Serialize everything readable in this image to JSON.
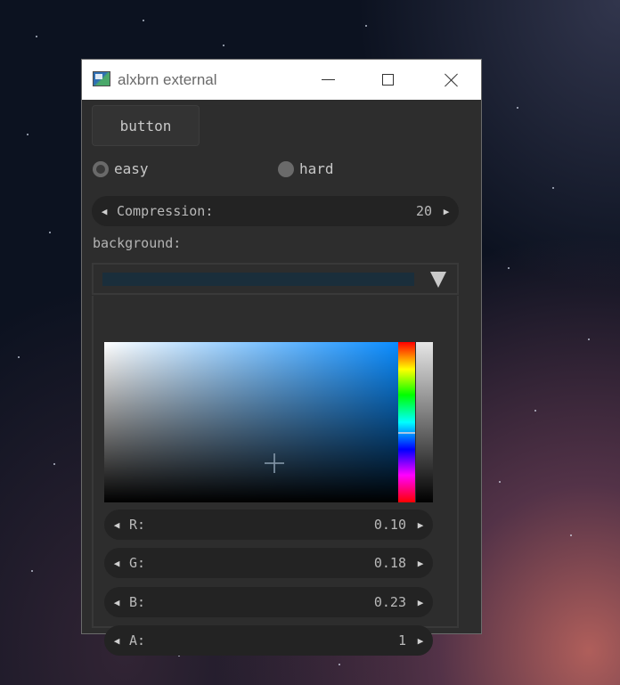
{
  "window": {
    "title": "alxbrn external"
  },
  "button": {
    "label": "button"
  },
  "difficulty": {
    "options": [
      {
        "label": "easy",
        "selected": true
      },
      {
        "label": "hard",
        "selected": false
      }
    ]
  },
  "compression": {
    "label": "Compression:",
    "value": "20"
  },
  "background": {
    "label": "background:",
    "swatch_color": "#1a2e3b",
    "channels": [
      {
        "label": "R:",
        "value": "0.10"
      },
      {
        "label": "G:",
        "value": "0.18"
      },
      {
        "label": "B:",
        "value": "0.23"
      },
      {
        "label": "A:",
        "value": "1"
      }
    ]
  },
  "icons": {
    "decrement": "◀",
    "increment": "▶"
  },
  "colors": {
    "window_bg": "#2d2d2d",
    "field_bg": "#232323",
    "text": "#b4b4b4",
    "hue_accent": "#0a8cff"
  }
}
